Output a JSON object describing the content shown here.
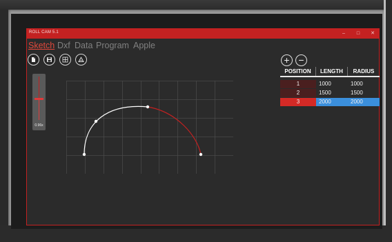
{
  "window": {
    "title": "ROLL CAM 5.1",
    "min_glyph": "–",
    "max_glyph": "□",
    "close_glyph": "✕"
  },
  "menu": [
    "Sketch",
    "Dxf",
    "Data",
    "Program",
    "Apple"
  ],
  "active_menu": "Sketch",
  "toolbar": [
    "new-file-icon",
    "save-icon",
    "grid-icon",
    "measure-icon"
  ],
  "zoom": {
    "value_label": "0.96x",
    "level": 0.47
  },
  "table_controls": {
    "add": "+",
    "remove": "−"
  },
  "table": {
    "headers": [
      "POSITION",
      "LENGTH",
      "RADIUS"
    ],
    "rows": [
      {
        "position": "1",
        "length": "1000",
        "radius": "1000"
      },
      {
        "position": "2",
        "length": "1500",
        "radius": "1500"
      },
      {
        "position": "3",
        "length": "2000",
        "radius": "2000"
      }
    ],
    "selected_row": 2
  },
  "colors": {
    "accent": "#c42121",
    "selected_row": "#d42a26",
    "selected_cell": "#3b8fdc",
    "path_white": "#ffffff",
    "path_red": "#c42121"
  }
}
